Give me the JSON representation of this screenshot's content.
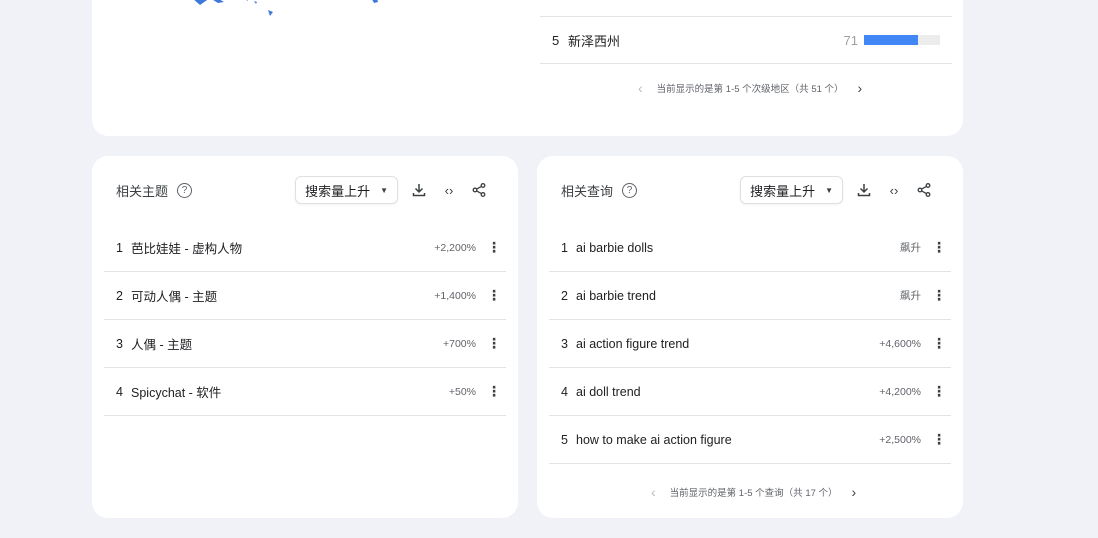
{
  "regions": {
    "row": {
      "rank": "5",
      "name": "新泽西州",
      "value": "71",
      "fraction": 0.71
    },
    "pager": "当前显示的是第 1-5 个次级地区（共 51 个）"
  },
  "topics": {
    "title": "相关主题",
    "dropdown": "搜索量上升",
    "items": [
      {
        "rank": "1",
        "label": "芭比娃娃 - 虚构人物",
        "value": "+2,200%"
      },
      {
        "rank": "2",
        "label": "可动人偶 - 主题",
        "value": "+1,400%"
      },
      {
        "rank": "3",
        "label": "人偶 - 主题",
        "value": "+700%"
      },
      {
        "rank": "4",
        "label": "Spicychat - 软件",
        "value": "+50%"
      }
    ]
  },
  "queries": {
    "title": "相关查询",
    "dropdown": "搜索量上升",
    "items": [
      {
        "rank": "1",
        "label": "ai barbie dolls",
        "value": "飙升"
      },
      {
        "rank": "2",
        "label": "ai barbie trend",
        "value": "飙升"
      },
      {
        "rank": "3",
        "label": "ai action figure trend",
        "value": "+4,600%"
      },
      {
        "rank": "4",
        "label": "ai doll trend",
        "value": "+4,200%"
      },
      {
        "rank": "5",
        "label": "how to make ai action figure",
        "value": "+2,500%"
      }
    ],
    "pager": "当前显示的是第 1-5 个查询（共 17 个）"
  },
  "colors": {
    "accent": "#4285f4",
    "map": "#3f78dd"
  }
}
